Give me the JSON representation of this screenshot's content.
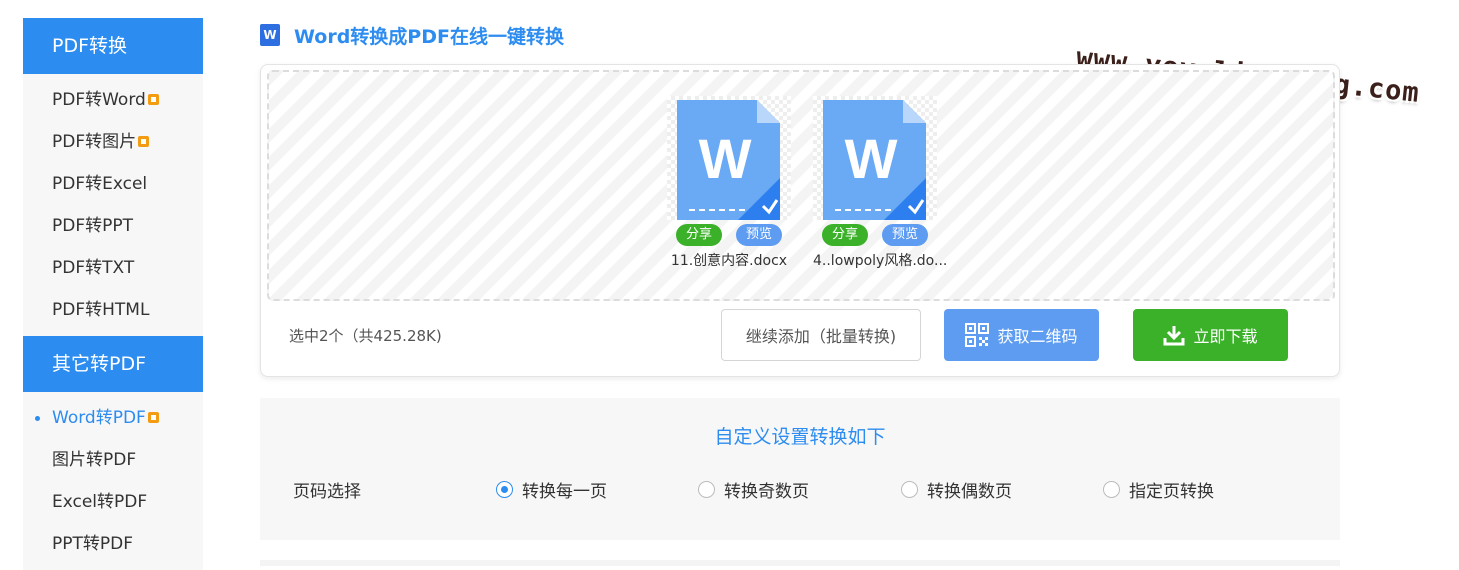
{
  "sidebar": {
    "sections": [
      {
        "title": "PDF转换",
        "items": [
          {
            "label": "PDF转Word",
            "badge": true
          },
          {
            "label": "PDF转图片",
            "badge": true
          },
          {
            "label": "PDF转Excel"
          },
          {
            "label": "PDF转PPT"
          },
          {
            "label": "PDF转TXT"
          },
          {
            "label": "PDF转HTML"
          }
        ]
      },
      {
        "title": "其它转PDF",
        "items": [
          {
            "label": "Word转PDF",
            "badge": true,
            "active": true
          },
          {
            "label": "图片转PDF"
          },
          {
            "label": "Excel转PDF"
          },
          {
            "label": "PPT转PDF"
          }
        ]
      }
    ]
  },
  "page": {
    "title": "Word转换成PDF在线一键转换",
    "title_icon": "W"
  },
  "watermark": "www.yeyulingfeng.com",
  "upload": {
    "files": [
      {
        "name": "11.创意内容.docx",
        "icon_letter": "W",
        "share_label": "分享",
        "preview_label": "预览"
      },
      {
        "name": "4..lowpoly风格.do...",
        "icon_letter": "W",
        "share_label": "分享",
        "preview_label": "预览"
      }
    ],
    "selection_info": "选中2个（共425.28K)",
    "add_more_label": "继续添加（批量转换)",
    "qrcode_label": "获取二维码",
    "download_label": "立即下载"
  },
  "settings": {
    "title": "自定义设置转换如下",
    "page_select_label": "页码选择",
    "options": [
      {
        "label": "转换每一页",
        "checked": true
      },
      {
        "label": "转换奇数页",
        "checked": false
      },
      {
        "label": "转换偶数页",
        "checked": false
      },
      {
        "label": "指定页转换",
        "checked": false
      }
    ]
  },
  "colors": {
    "primary": "#2d8cf0",
    "green": "#3bb12a",
    "badge": "#f39c12",
    "doc_blue": "#6aaaf5"
  }
}
